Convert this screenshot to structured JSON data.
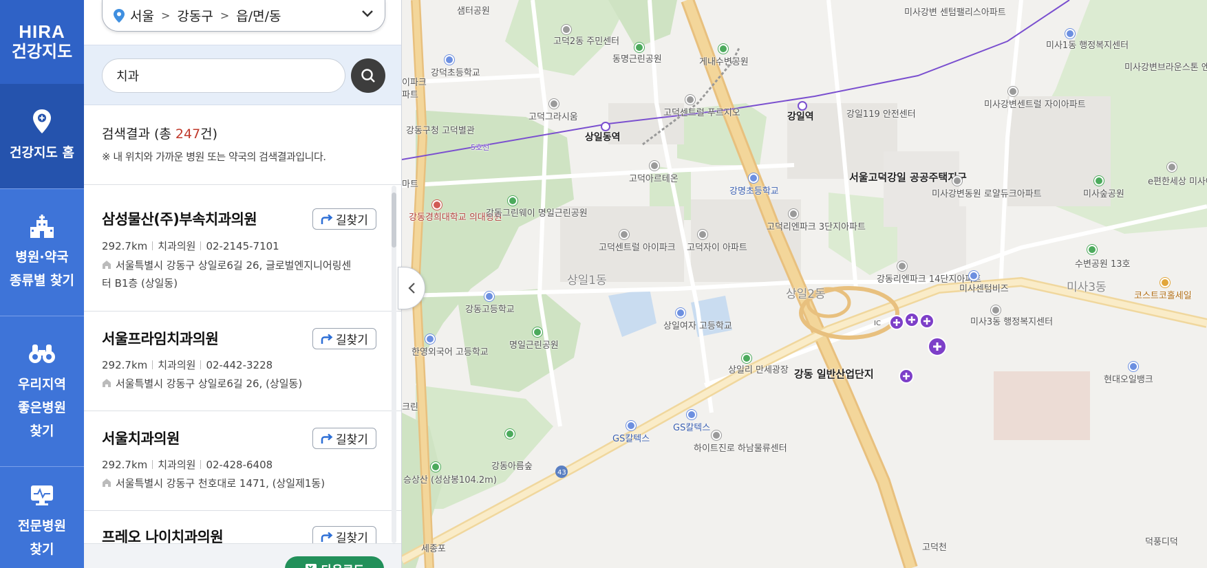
{
  "nav": {
    "logo_line1": "HIRA",
    "logo_line2": "건강지도",
    "items": [
      {
        "icon": "map-pin-icon",
        "label": "건강지도 홈"
      },
      {
        "icon": "hospital-building-icon",
        "label_line1": "병원·약국",
        "label_line2": "종류별 찾기"
      },
      {
        "icon": "binoculars-icon",
        "label_line1": "우리지역",
        "label_line2": "좋은병원",
        "label_line3": "찾기"
      },
      {
        "icon": "medical-monitor-icon",
        "label_line1": "전문병원",
        "label_line2": "찾기"
      }
    ]
  },
  "region": {
    "city": "서울",
    "district": "강동구",
    "dong": "읍/면/동"
  },
  "search": {
    "query": "치과"
  },
  "summary": {
    "prefix": "검색결과 (총 ",
    "count": "247",
    "suffix": "건)",
    "note": "※ 내 위치와 가까운 병원 또는 약국의 검색결과입니다."
  },
  "route_label": "길찾기",
  "results": [
    {
      "name": "삼성물산(주)부속치과의원",
      "distance": "292.7km",
      "type": "치과의원",
      "phone": "02-2145-7101",
      "address": "서울특별시 강동구 상일로6길 26, 글로벌엔지니어링센터 B1층 (상일동)"
    },
    {
      "name": "서울프라임치과의원",
      "distance": "292.7km",
      "type": "치과의원",
      "phone": "02-442-3228",
      "address": "서울특별시 강동구 상일로6길 26, (상일동)"
    },
    {
      "name": "서울치과의원",
      "distance": "292.7km",
      "type": "치과의원",
      "phone": "02-428-6408",
      "address": "서울특별시 강동구 천호대로 1471, (상일제1동)"
    },
    {
      "name": "프레오 나이치과의원"
    }
  ],
  "download_label": "다운로드",
  "colors": {
    "nav_bg": "#3e74d8",
    "nav_active": "#2553ad",
    "accent_red": "#c0392b",
    "download_green": "#22905a",
    "line5_purple": "#7a4fcf",
    "pin_purple": "#7d3fc8"
  },
  "map": {
    "labels": [
      "샘터공원",
      "고덕2동 주민센터",
      "동명근린공원",
      "게내수변공원",
      "미사강변 센텀팰리스아파트",
      "미사1동 행정복지센터",
      "미사강변브라운스톤 엔에이치에프아파트",
      "강덕초등학교",
      "고덕그라시움",
      "고덕센트럴 푸르지오",
      "상일동역",
      "강일역",
      "5호선",
      "강일119 안전센터",
      "미사강변센트럴 자이아파트",
      "강동구청 고덕별관",
      "고덕아르테온",
      "강명초등학교",
      "서울고덕강일 공공주택지구",
      "미사강변동원 로얄듀크아파트",
      "미사숲공원",
      "e편한세상 미사아파트",
      "강동경희대학교 의대병원",
      "강동그린웨이 명일근린공원",
      "고덕센트럴 아이파크",
      "고덕자이 아파트",
      "고덕리엔파크 3단지아파트",
      "상일1동",
      "상일2동",
      "강동리엔파크 14단지아파트",
      "미사센텀비즈",
      "수변공원 13호",
      "미사3동",
      "코스트코홀세일",
      "강동고등학교",
      "상일여자 고등학교",
      "명일근린공원",
      "한영외국어 고등학교",
      "미사3동 행정복지센터",
      "상일리 만세광장",
      "강동 일반산업단지",
      "현대오일뱅크",
      "GS칼텍스",
      "GS칼텍스",
      "하이트진로 하남물류센터",
      "강동아름숲",
      "승상산 (성삼봉104.2m)",
      "고덕천",
      "43",
      "IC",
      "이파크",
      "파트",
      "마트",
      "크린",
      "세종포",
      "덕풍디덕"
    ]
  }
}
